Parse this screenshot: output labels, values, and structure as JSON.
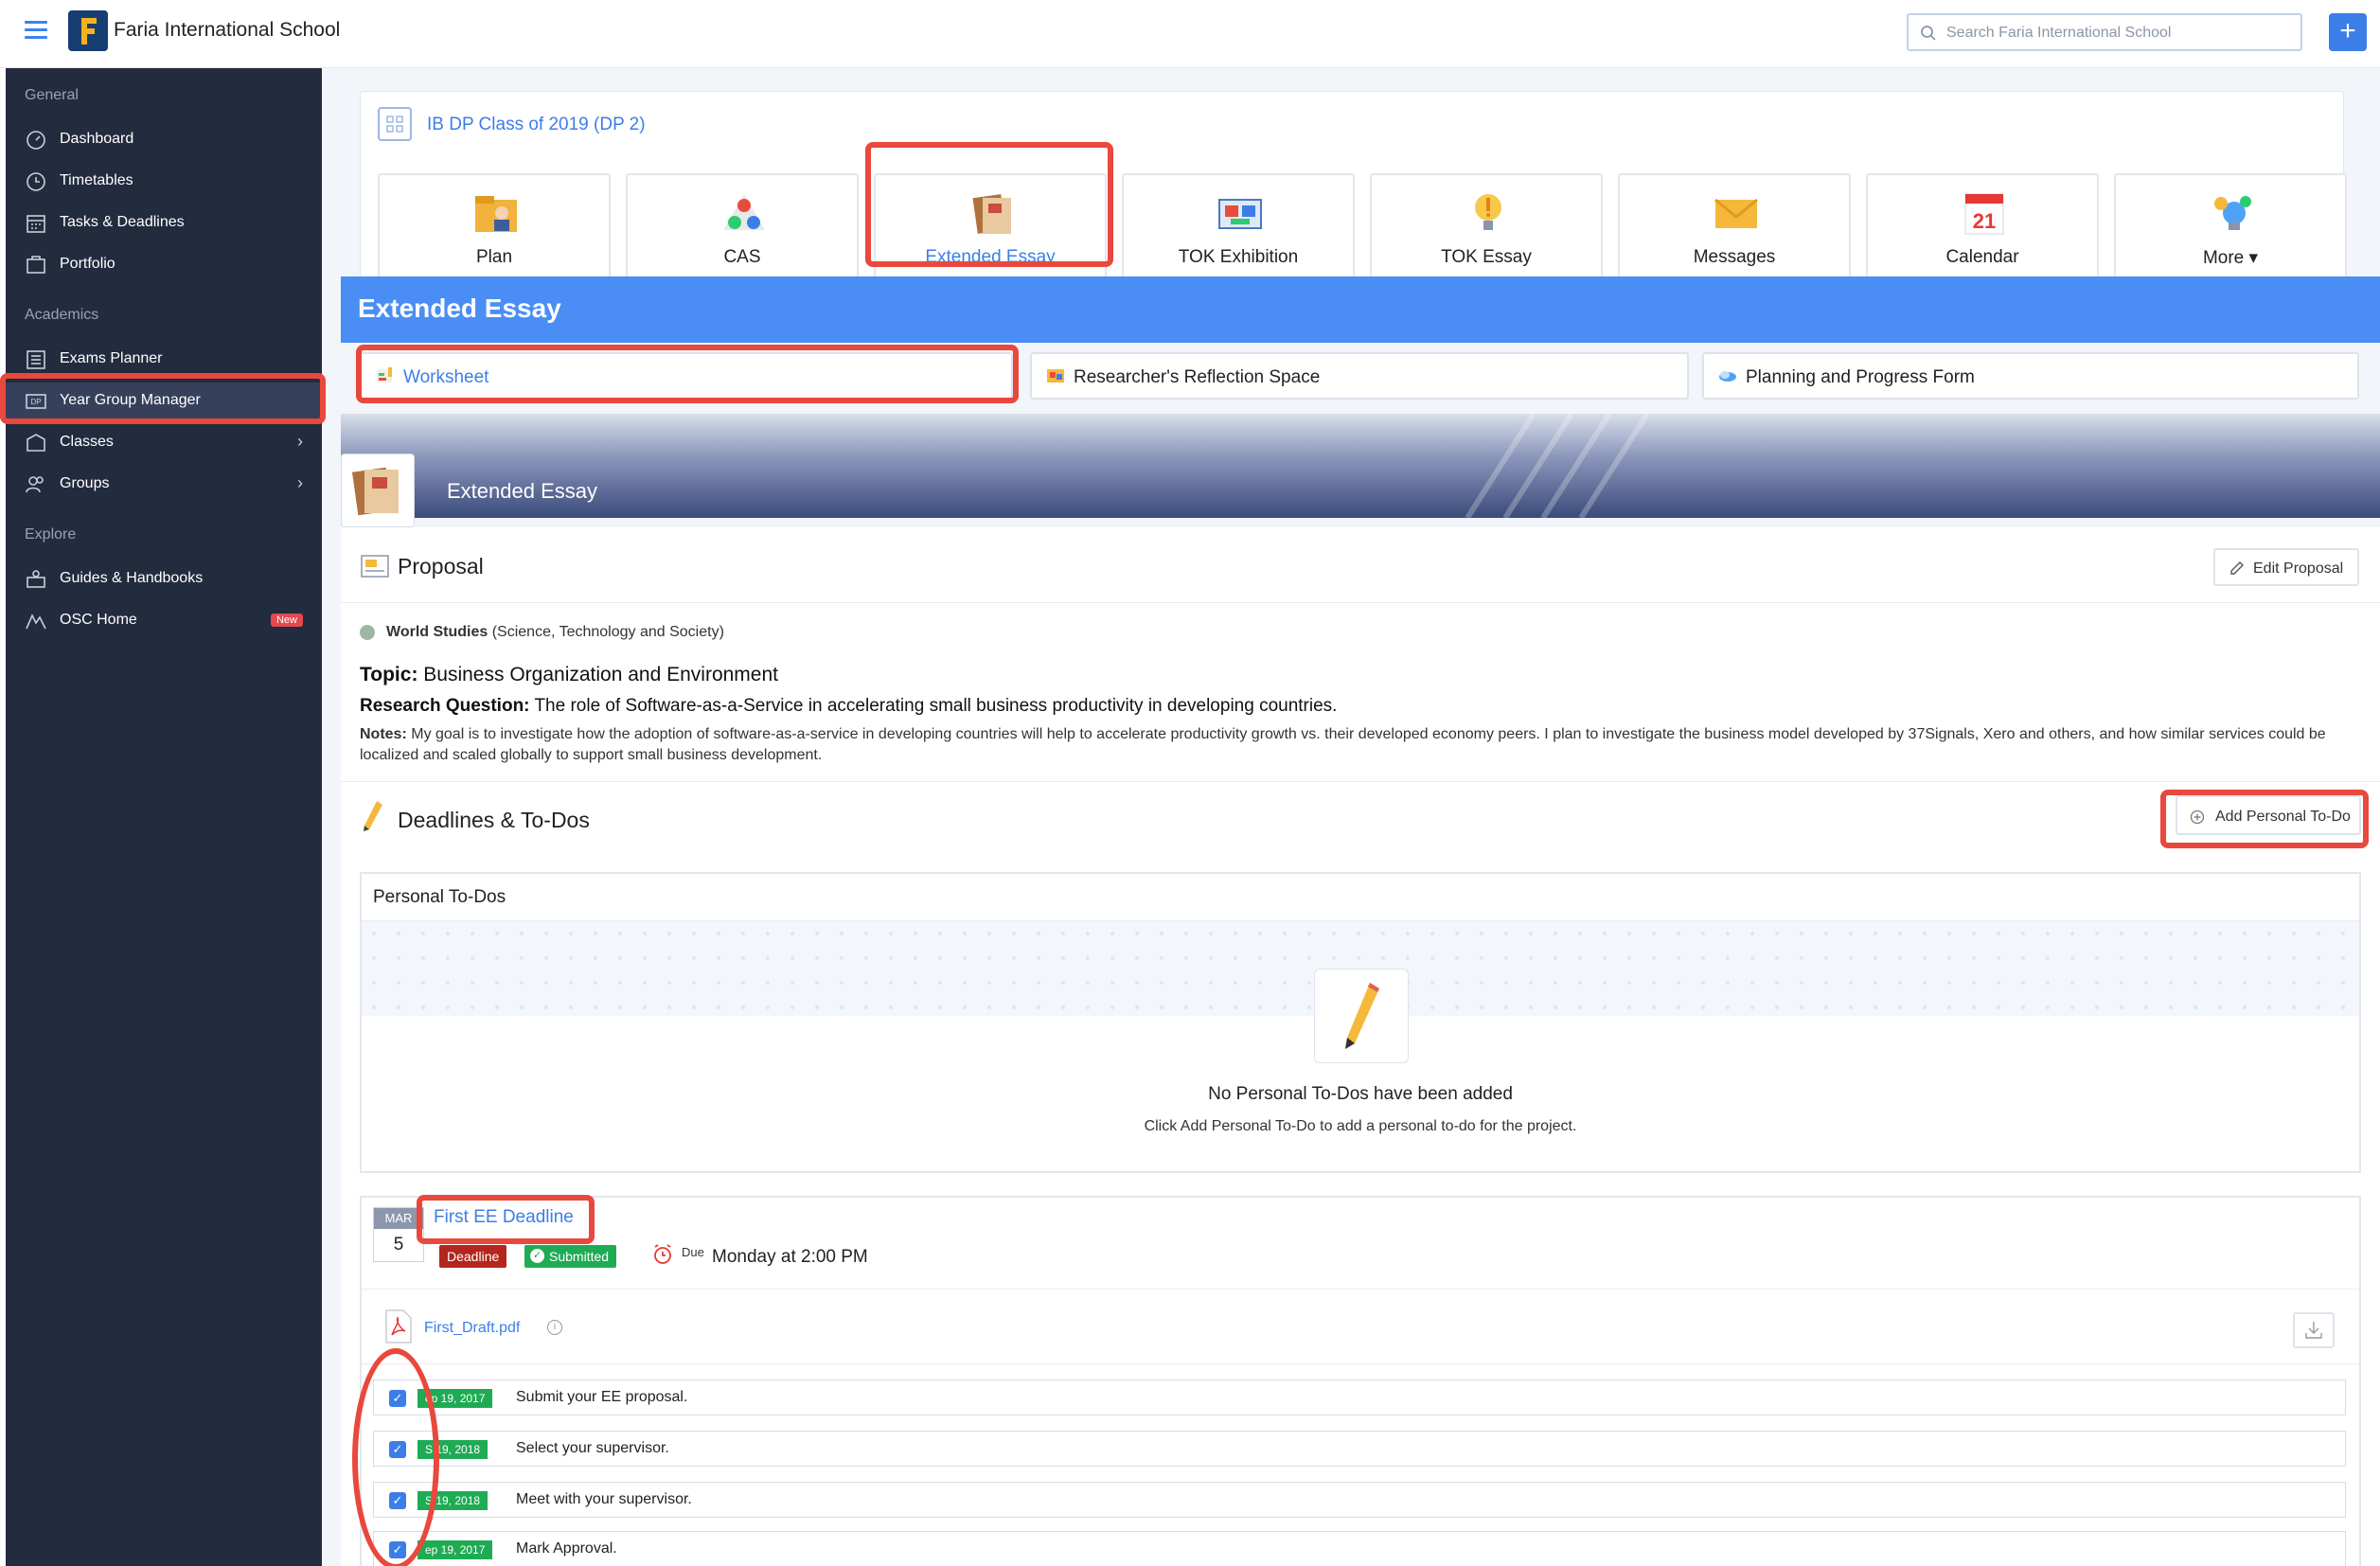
{
  "header": {
    "school_name": "Faria International School",
    "search_placeholder": "Search Faria International School"
  },
  "sidebar": {
    "sections": [
      {
        "label": "General"
      },
      {
        "label": "Academics"
      },
      {
        "label": "Explore"
      }
    ],
    "items": [
      {
        "label": "Dashboard"
      },
      {
        "label": "Timetables"
      },
      {
        "label": "Tasks & Deadlines"
      },
      {
        "label": "Portfolio"
      },
      {
        "label": "Exams Planner"
      },
      {
        "label": "Year Group Manager"
      },
      {
        "label": "Classes"
      },
      {
        "label": "Groups"
      },
      {
        "label": "Guides & Handbooks"
      },
      {
        "label": "OSC Home",
        "badge": "New"
      }
    ]
  },
  "class": {
    "title": "IB DP Class of 2019 (DP 2)",
    "tiles": [
      {
        "label": "Plan",
        "icon": "plan-icon"
      },
      {
        "label": "CAS",
        "icon": "cas-icon"
      },
      {
        "label": "Extended Essay",
        "icon": "extended-essay-icon"
      },
      {
        "label": "TOK Exhibition",
        "icon": "tok-exhibition-icon"
      },
      {
        "label": "TOK Essay",
        "icon": "tok-essay-icon"
      },
      {
        "label": "Messages",
        "icon": "messages-icon"
      },
      {
        "label": "Calendar",
        "icon": "calendar-icon",
        "day": "21"
      },
      {
        "label": "More",
        "icon": "more-icon"
      }
    ]
  },
  "ee": {
    "header": "Extended Essay",
    "subtabs": [
      {
        "label": "Worksheet"
      },
      {
        "label": "Researcher's Reflection Space"
      },
      {
        "label": "Planning and Progress Form"
      }
    ],
    "banner_title": "Extended Essay",
    "proposal": {
      "title": "Proposal",
      "edit_label": "Edit Proposal",
      "subject": "World Studies",
      "subject_detail": "(Science, Technology and Society)",
      "topic_label": "Topic:",
      "topic": "Business Organization and Environment",
      "rq_label": "Research Question:",
      "rq": "The role of Software-as-a-Service in accelerating small business productivity in developing countries.",
      "notes_label": "Notes:",
      "notes": "My goal is to investigate how the adoption of software-as-a-service in developing countries will help to accelerate productivity growth vs. their developed economy peers. I plan to investigate the business model developed by 37Signals, Xero and others, and how similar services could be localized and scaled globally to support small business development."
    },
    "deadlines": {
      "title": "Deadlines & To-Dos",
      "add_label": "Add Personal To-Do",
      "personal_title": "Personal To-Dos",
      "empty_title": "No Personal To-Dos have been added",
      "empty_sub": "Click Add Personal To-Do to add a personal to-do for the project.",
      "item": {
        "month": "MAR",
        "day": "5",
        "name": "First EE Deadline",
        "tag_deadline": "Deadline",
        "tag_submitted": "Submitted",
        "due_label": "Due",
        "due_value": "Monday at 2:00 PM",
        "file": "First_Draft.pdf"
      },
      "tasks": [
        {
          "date": "ep 19, 2017",
          "text": "Submit your EE proposal."
        },
        {
          "date": "S  19, 2018",
          "text": "Select your supervisor."
        },
        {
          "date": "S  19, 2018",
          "text": "Meet with your supervisor."
        },
        {
          "date": "ep 19, 2017",
          "text": "Mark Approval."
        }
      ]
    }
  },
  "colors": {
    "accent": "#3b7ee8",
    "sidebar_bg": "#232b3e",
    "highlight": "#e9483d",
    "success": "#1fab54",
    "danger": "#b3261e"
  }
}
